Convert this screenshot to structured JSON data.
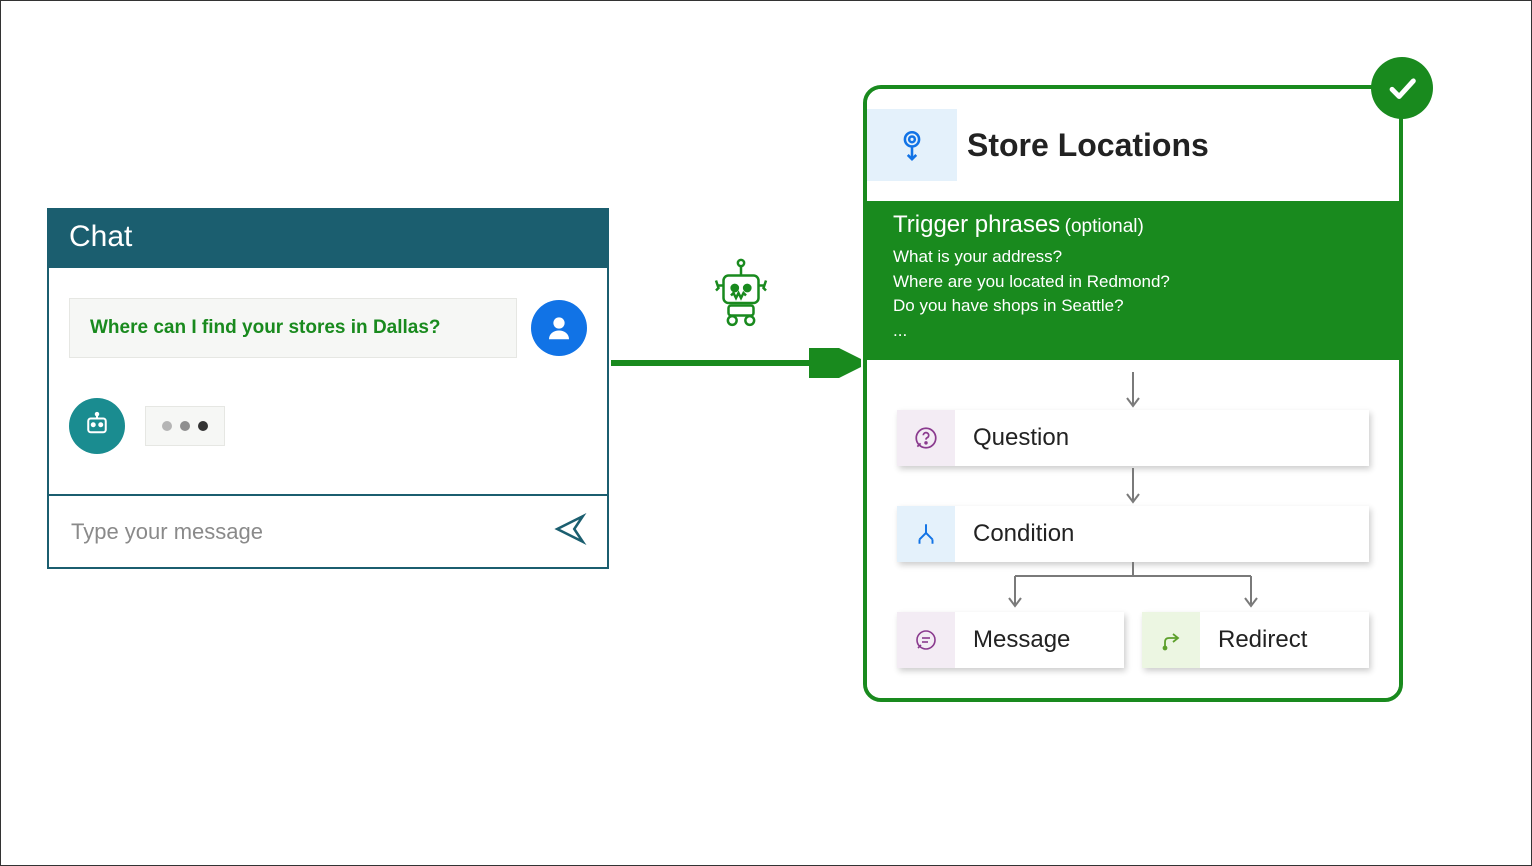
{
  "chat": {
    "header": "Chat",
    "user_msg": "Where can I find your stores in Dallas?",
    "input_placeholder": "Type your message"
  },
  "topic": {
    "title": "Store Locations",
    "trigger_label": "Trigger phrases",
    "trigger_optional": "(optional)",
    "trigger_lines": [
      "What is your address?",
      "Where are you located in Redmond?",
      "Do you have shops in Seattle?",
      "..."
    ],
    "nodes": {
      "question": "Question",
      "condition": "Condition",
      "message": "Message",
      "redirect": "Redirect"
    }
  },
  "colors": {
    "teal": "#1b5e6f",
    "green": "#198a1e",
    "blue": "#1173e6",
    "pale_blue": "#e4f1fb",
    "pale_purple": "#f3ecf4",
    "pale_green": "#ecf6e2"
  }
}
